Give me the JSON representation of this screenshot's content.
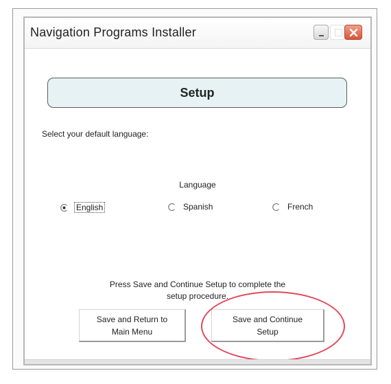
{
  "window": {
    "title": "Navigation Programs Installer",
    "controls": [
      "minimize-icon",
      "maximize-icon",
      "close-icon"
    ],
    "close_color": "#d6553b"
  },
  "header": {
    "title": "Setup",
    "background": "#e6f2f4"
  },
  "prompt": "Select your default language:",
  "language": {
    "label": "Language",
    "options": [
      {
        "label": "English",
        "selected": true
      },
      {
        "label": "Spanish",
        "selected": false
      },
      {
        "label": "French",
        "selected": false
      }
    ]
  },
  "instructions": "Press Save and Continue Setup to complete the\nsetup procedure.",
  "buttons": {
    "return_label": "Save and Return to\nMain Menu",
    "continue_label": "Save and Continue\nSetup"
  },
  "annotation": {
    "highlight_color": "#e2485a",
    "highlighted": "Save and Continue Setup"
  }
}
